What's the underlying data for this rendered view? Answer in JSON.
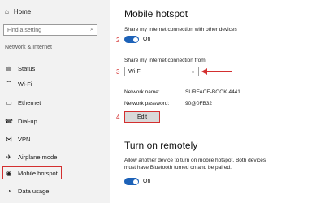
{
  "sidebar": {
    "home_label": "Home",
    "search_placeholder": "Find a setting",
    "section_label": "Network & Internet",
    "items": [
      {
        "label": "Status",
        "icon": "globe-icon"
      },
      {
        "label": "Wi-Fi",
        "icon": "wifi-icon"
      },
      {
        "label": "Ethernet",
        "icon": "ethernet-icon"
      },
      {
        "label": "Dial-up",
        "icon": "phone-icon"
      },
      {
        "label": "VPN",
        "icon": "vpn-icon"
      },
      {
        "label": "Airplane mode",
        "icon": "airplane-icon"
      },
      {
        "label": "Mobile hotspot",
        "icon": "hotspot-icon",
        "selected": true
      },
      {
        "label": "Data usage",
        "icon": "data-usage-icon"
      }
    ]
  },
  "main": {
    "title": "Mobile hotspot",
    "share_label": "Share my Internet connection with other devices",
    "toggle1_state": "On",
    "share_from_label": "Share my Internet connection from",
    "share_from_value": "Wi-Fi",
    "network_name_label": "Network name:",
    "network_name_value": "SURFACE-BOOK 4441",
    "network_password_label": "Network password:",
    "network_password_value": "90@0FB32",
    "edit_label": "Edit",
    "turn_on_remotely_title": "Turn on remotely",
    "remote_desc_line1": "Allow another device to turn on mobile hotspot. Both devices",
    "remote_desc_line2": "must have Bluetooth turned on and be paired.",
    "toggle2_state": "On"
  },
  "annotations": {
    "step2": "2",
    "step3": "3",
    "step4": "4"
  },
  "colors": {
    "accent": "#1d62b8",
    "annotation_red": "#d32f2f"
  }
}
